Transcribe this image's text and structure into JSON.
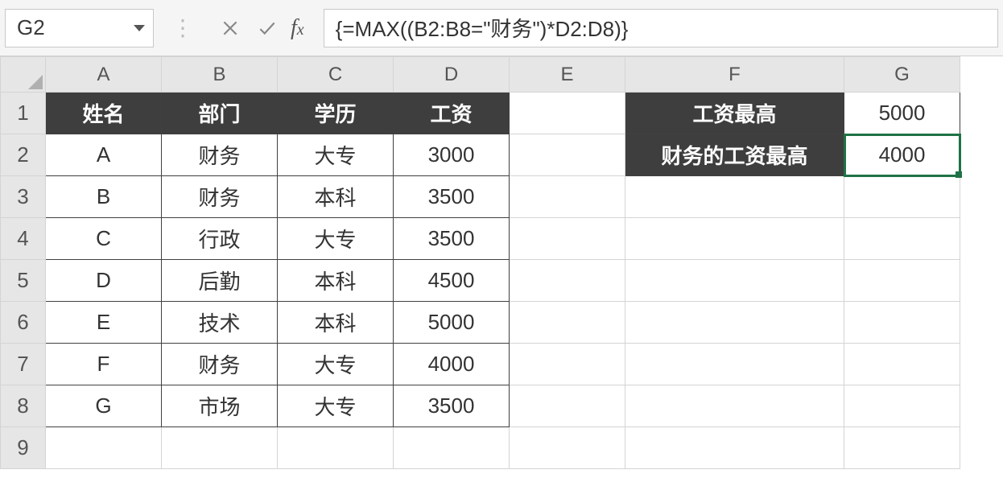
{
  "nameBox": "G2",
  "formula": "{=MAX((B2:B8=\"财务\")*D2:D8)}",
  "columns": [
    "A",
    "B",
    "C",
    "D",
    "E",
    "F",
    "G"
  ],
  "rows": [
    "1",
    "2",
    "3",
    "4",
    "5",
    "6",
    "7",
    "8",
    "9"
  ],
  "headersRow1": {
    "A": "姓名",
    "B": "部门",
    "C": "学历",
    "D": "工资",
    "F": "工资最高",
    "G": "5000"
  },
  "headersRow2": {
    "F": "财务的工资最高",
    "G": "4000"
  },
  "tableData": [
    {
      "A": "A",
      "B": "财务",
      "C": "大专",
      "D": "3000"
    },
    {
      "A": "B",
      "B": "财务",
      "C": "本科",
      "D": "3500"
    },
    {
      "A": "C",
      "B": "行政",
      "C": "大专",
      "D": "3500"
    },
    {
      "A": "D",
      "B": "后勤",
      "C": "本科",
      "D": "4500"
    },
    {
      "A": "E",
      "B": "技术",
      "C": "本科",
      "D": "5000"
    },
    {
      "A": "F",
      "B": "财务",
      "C": "大专",
      "D": "4000"
    },
    {
      "A": "G",
      "B": "市场",
      "C": "大专",
      "D": "3500"
    }
  ],
  "selectedCell": "G2"
}
